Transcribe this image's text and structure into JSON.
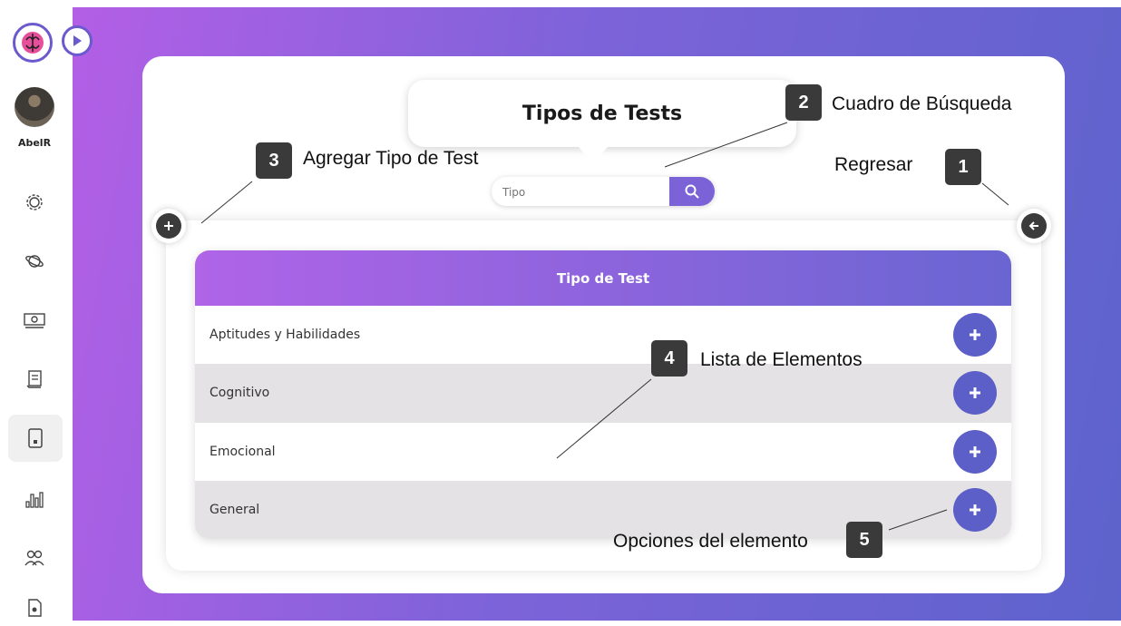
{
  "sidebar": {
    "username": "AbelR",
    "items": [
      {
        "icon": "gear-icon"
      },
      {
        "icon": "planet-icon"
      },
      {
        "icon": "money-icon"
      },
      {
        "icon": "scroll-icon"
      },
      {
        "icon": "tablet-icon",
        "active": true
      },
      {
        "icon": "chart-bars-icon"
      },
      {
        "icon": "users-icon"
      },
      {
        "icon": "document-icon"
      }
    ]
  },
  "header": {
    "title": "Tipos de Tests"
  },
  "search": {
    "placeholder": "Tipo"
  },
  "table": {
    "header": "Tipo de Test",
    "rows": [
      {
        "label": "Aptitudes y Habilidades"
      },
      {
        "label": "Cognitivo"
      },
      {
        "label": "Emocional"
      },
      {
        "label": "General"
      }
    ]
  },
  "annotations": [
    {
      "number": "1",
      "text": "Regresar"
    },
    {
      "number": "2",
      "text": "Cuadro de Búsqueda"
    },
    {
      "number": "3",
      "text": "Agregar Tipo de Test"
    },
    {
      "number": "4",
      "text": "Lista de Elementos"
    },
    {
      "number": "5",
      "text": "Opciones del elemento"
    }
  ],
  "colors": {
    "accent": "#5b5fc7",
    "gradient_start": "#b064e8",
    "gradient_end": "#6a65d2"
  }
}
